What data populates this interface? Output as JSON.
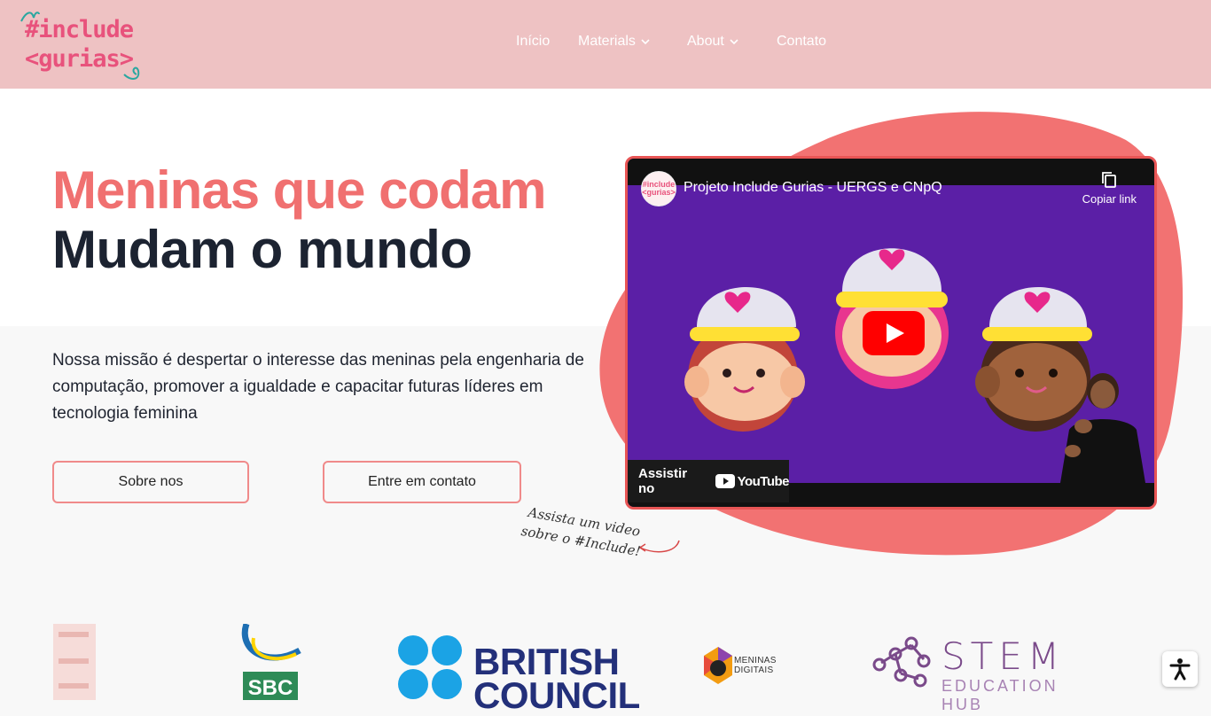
{
  "brand": {
    "logo_line1": "#include",
    "logo_line2": "<gurias>",
    "accent": "#e8527c",
    "header_bg": "#eec2c3",
    "coral": "#f07070"
  },
  "nav": {
    "items": [
      {
        "label": "Início",
        "has_dropdown": false
      },
      {
        "label": "Materials",
        "has_dropdown": true
      },
      {
        "label": "About",
        "has_dropdown": true
      },
      {
        "label": "Contato",
        "has_dropdown": false
      }
    ]
  },
  "hero": {
    "headline_line1": "Meninas que codam",
    "headline_line2": "Mudam o mundo",
    "mission": "Nossa missão é despertar o interesse das meninas pela engenharia de computação, promover a igualdade e capacitar futuras líderes em tecnologia feminina",
    "btn_about": "Sobre nos",
    "btn_contact": "Entre em contato",
    "handnote_line1": "Assista um video",
    "handnote_line2": "sobre o #Include!"
  },
  "video": {
    "title": "Projeto Include Gurias - UERGS e CNpQ",
    "channel_avatar_line1": "#include",
    "channel_avatar_line2": "<gurias>",
    "copy_link": "Copiar link",
    "watch_on": "Assistir no",
    "youtube": "YouTube",
    "bg_color": "#5b1fa6"
  },
  "partners": {
    "british_council_line1": "BRITISH",
    "british_council_line2": "COUNCIL",
    "sbc": "SBC",
    "meninas_digitais_line1": "MENINAS",
    "meninas_digitais_line2": "DIGITAIS",
    "stem": "STEM",
    "stem_sub": "EDUCATION HUB"
  },
  "accessibility": {
    "icon": "accessibility-icon"
  }
}
